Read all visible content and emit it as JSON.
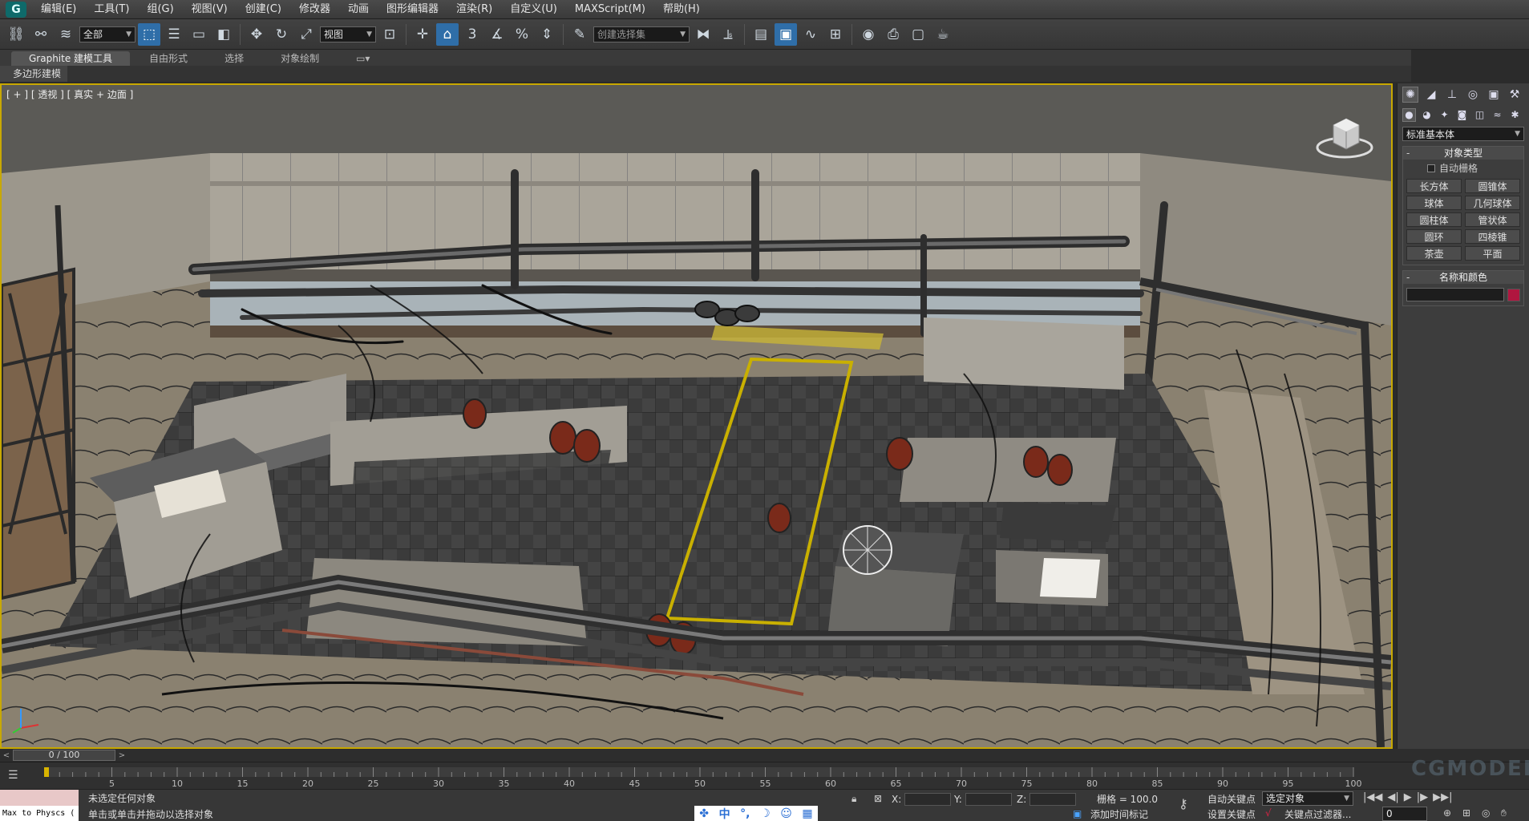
{
  "menu": {
    "logo_text": "G",
    "items": [
      "编辑(E)",
      "工具(T)",
      "组(G)",
      "视图(V)",
      "创建(C)",
      "修改器",
      "动画",
      "图形编辑器",
      "渲染(R)",
      "自定义(U)",
      "MAXScript(M)",
      "帮助(H)"
    ]
  },
  "toolbar": {
    "filter_select": "全部",
    "ref_coord_select": "视图",
    "selection_set_placeholder": "创建选择集",
    "snap_label": "3"
  },
  "ribbon": {
    "tabs": [
      "Graphite 建模工具",
      "自由形式",
      "选择",
      "对象绘制"
    ],
    "active_tab": 0,
    "sub_label": "多边形建模"
  },
  "viewport": {
    "label": "[ + ] [ 透视 ] [ 真实 + 边面 ]"
  },
  "command_panel": {
    "category_dropdown": "标准基本体",
    "object_type_title": "对象类型",
    "autogrid_label": "自动栅格",
    "object_buttons": [
      "长方体",
      "圆锥体",
      "球体",
      "几何球体",
      "圆柱体",
      "管状体",
      "圆环",
      "四棱锥",
      "茶壶",
      "平面"
    ],
    "name_color_title": "名称和颜色",
    "color": "#b0163f"
  },
  "time": {
    "frame_readout": "0 / 100",
    "ticks": [
      5,
      10,
      15,
      20,
      25,
      30,
      35,
      40,
      45,
      50,
      55,
      60,
      65,
      70,
      75,
      80,
      85,
      90,
      95,
      100
    ]
  },
  "status": {
    "script_label": "Max to Physcs (",
    "message_top": "未选定任何对象",
    "message_bottom": "单击或单击并拖动以选择对象",
    "x_label": "X:",
    "y_label": "Y:",
    "z_label": "Z:",
    "grid_label": "栅格 = 100.0",
    "add_time_tag": "添加时间标记",
    "auto_key": "自动关键点",
    "set_key": "设置关键点",
    "selected_object_select": "选定对象",
    "key_filters": "关键点过滤器...",
    "frame_field": "0",
    "ime_items": [
      "中",
      "°,",
      "☽",
      "☺",
      "▦"
    ]
  },
  "watermark": "CGMODEL.CN"
}
